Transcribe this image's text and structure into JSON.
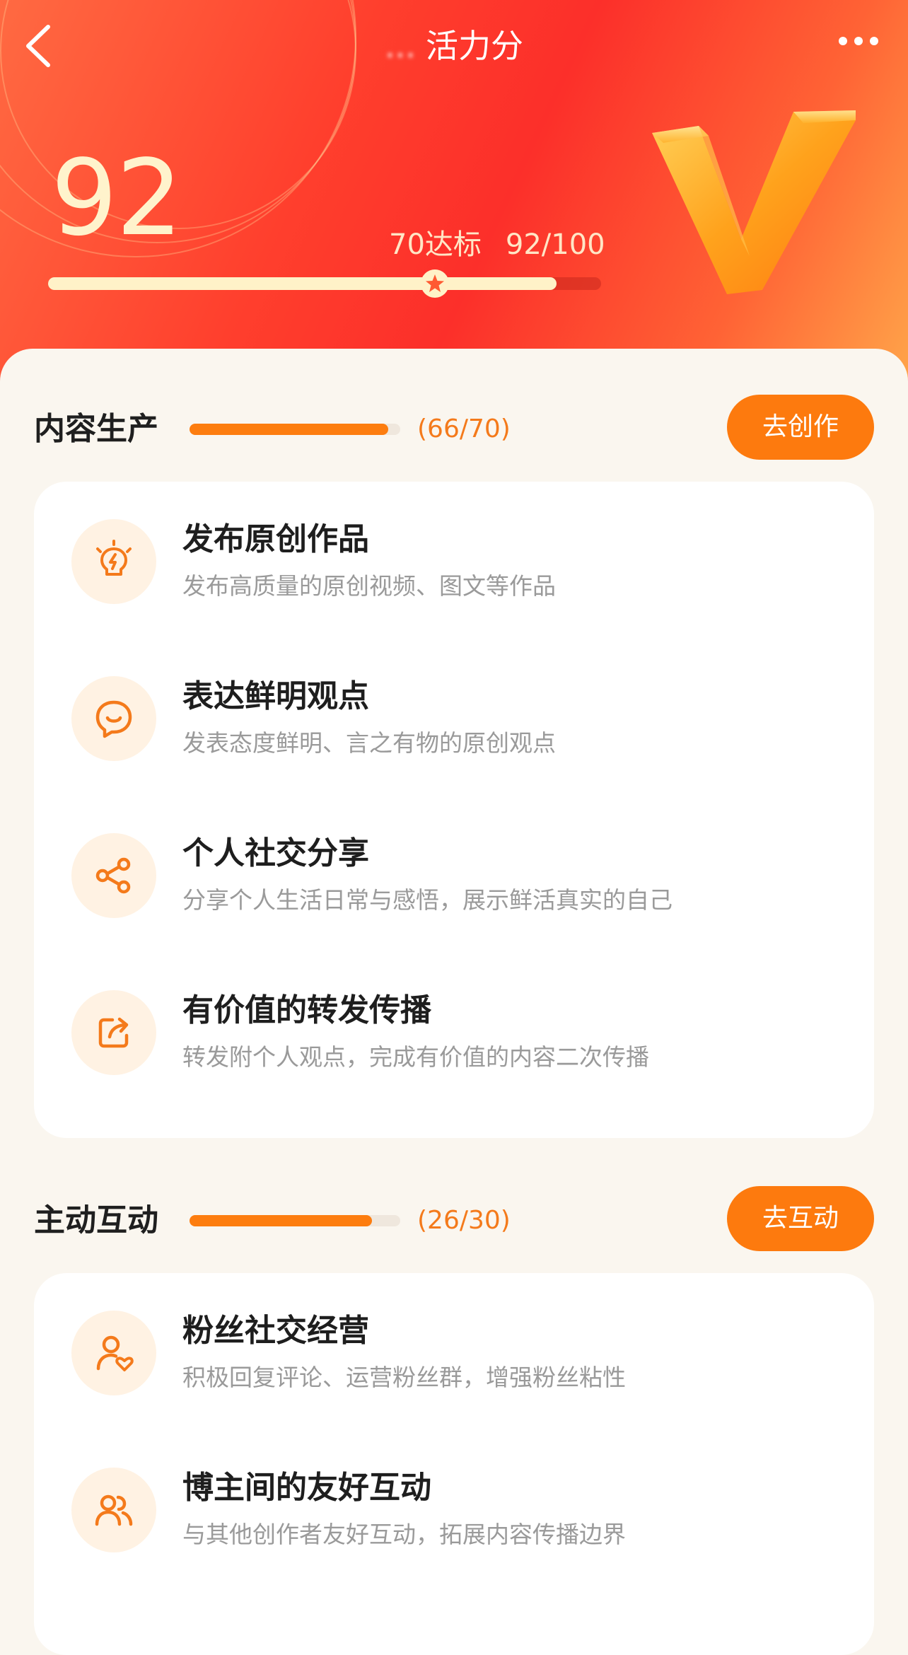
{
  "nav": {
    "title_prefix": "...",
    "title": "活力分"
  },
  "score": {
    "value": "92",
    "target_label": "70达标",
    "progress_label": "92/100",
    "progress_fraction": 0.92,
    "target_fraction": 0.7
  },
  "sections": [
    {
      "title": "内容生产",
      "count": "(66/70)",
      "progress_fraction": 0.943,
      "button": "去创作",
      "items": [
        {
          "icon": "lightbulb-icon",
          "title": "发布原创作品",
          "desc": "发布高质量的原创视频、图文等作品"
        },
        {
          "icon": "chat-smile-icon",
          "title": "表达鲜明观点",
          "desc": "发表态度鲜明、言之有物的原创观点"
        },
        {
          "icon": "share-icon",
          "title": "个人社交分享",
          "desc": "分享个人生活日常与感悟，展示鲜活真实的自己"
        },
        {
          "icon": "forward-icon",
          "title": "有价值的转发传播",
          "desc": "转发附个人观点，完成有价值的内容二次传播"
        }
      ]
    },
    {
      "title": "主动互动",
      "count": "(26/30)",
      "progress_fraction": 0.867,
      "button": "去互动",
      "items": [
        {
          "icon": "user-heart-icon",
          "title": "粉丝社交经营",
          "desc": "积极回复评论、运营粉丝群，增强粉丝粘性"
        },
        {
          "icon": "users-icon",
          "title": "博主间的友好互动",
          "desc": "与其他创作者友好互动，拓展内容传播边界"
        }
      ]
    }
  ],
  "colors": {
    "accent": "#fd7a0e",
    "header_red": "#fc2f2a",
    "score_text": "#fff3cc",
    "icon_bg": "#fff2e3"
  }
}
